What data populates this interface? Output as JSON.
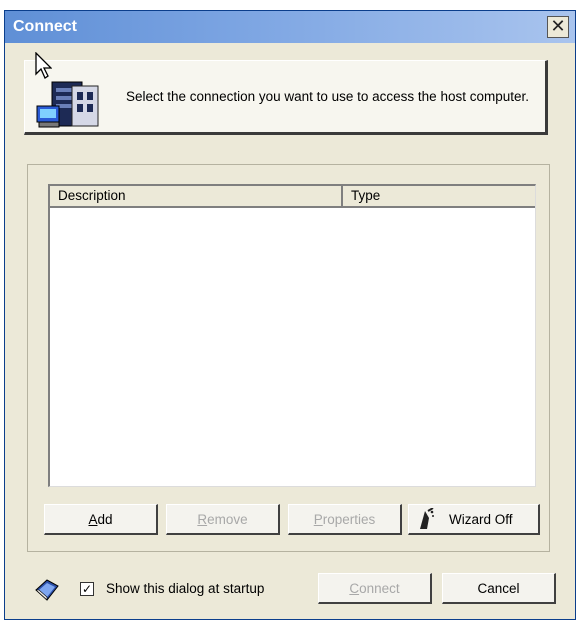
{
  "window": {
    "title": "Connect",
    "close_glyph": "✕"
  },
  "header": {
    "message": "Select the connection you want to use to access the host computer.",
    "icon": "computer-network-icon"
  },
  "list": {
    "columns": [
      "Description",
      "Type"
    ],
    "rows": []
  },
  "buttons": {
    "add": {
      "label_accel": "A",
      "label_rest": "dd",
      "enabled": true
    },
    "remove": {
      "label_accel": "R",
      "label_rest": "emove",
      "enabled": false
    },
    "properties": {
      "label_accel": "P",
      "label_rest": "roperties",
      "enabled": false
    },
    "wizard": {
      "label": "Wizard Off",
      "icon": "wizard-icon",
      "enabled": true
    },
    "connect": {
      "label_accel": "C",
      "label_rest": "onnect",
      "enabled": false
    },
    "cancel": {
      "label": "Cancel",
      "enabled": true
    }
  },
  "footer": {
    "checkbox_label": "Show this dialog at startup",
    "checkbox_checked": true,
    "checkbox_glyph": "✓",
    "help_icon": "help-book-icon"
  },
  "colors": {
    "titlebar_start": "#5f8fd6",
    "titlebar_end": "#a9c4ee",
    "dialog_bg": "#ece9d8",
    "disabled_text": "#a8a8a8"
  }
}
